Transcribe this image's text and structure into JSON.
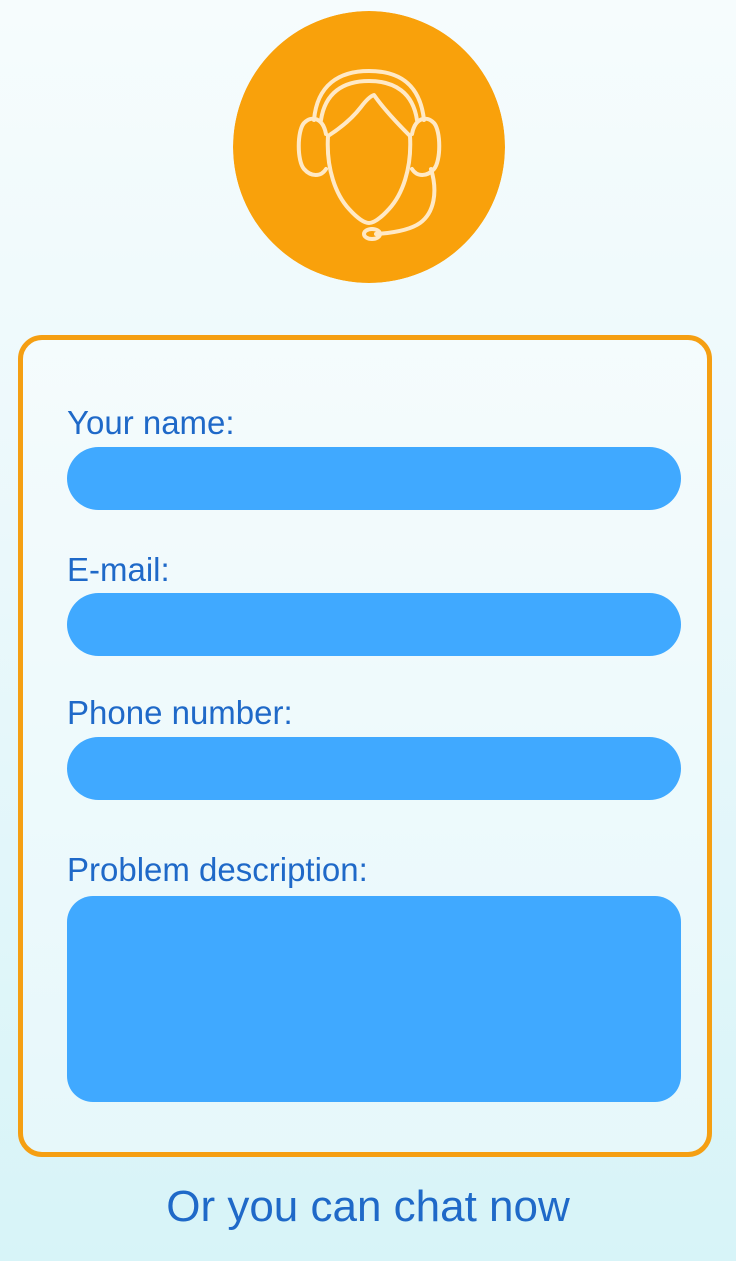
{
  "avatar": {
    "icon": "support-agent-headset-icon",
    "bg_color": "#f9a10b",
    "line_color": "#ffe9c6"
  },
  "form": {
    "name_label": "Your name:",
    "email_label": "E-mail:",
    "phone_label": "Phone number:",
    "description_label": "Problem description:",
    "name_value": "",
    "email_value": "",
    "phone_value": "",
    "description_value": ""
  },
  "footer": {
    "chat_link": "Or you can chat now"
  },
  "colors": {
    "accent": "#f59f12",
    "field": "#40a9ff",
    "text": "#1f69c8"
  }
}
